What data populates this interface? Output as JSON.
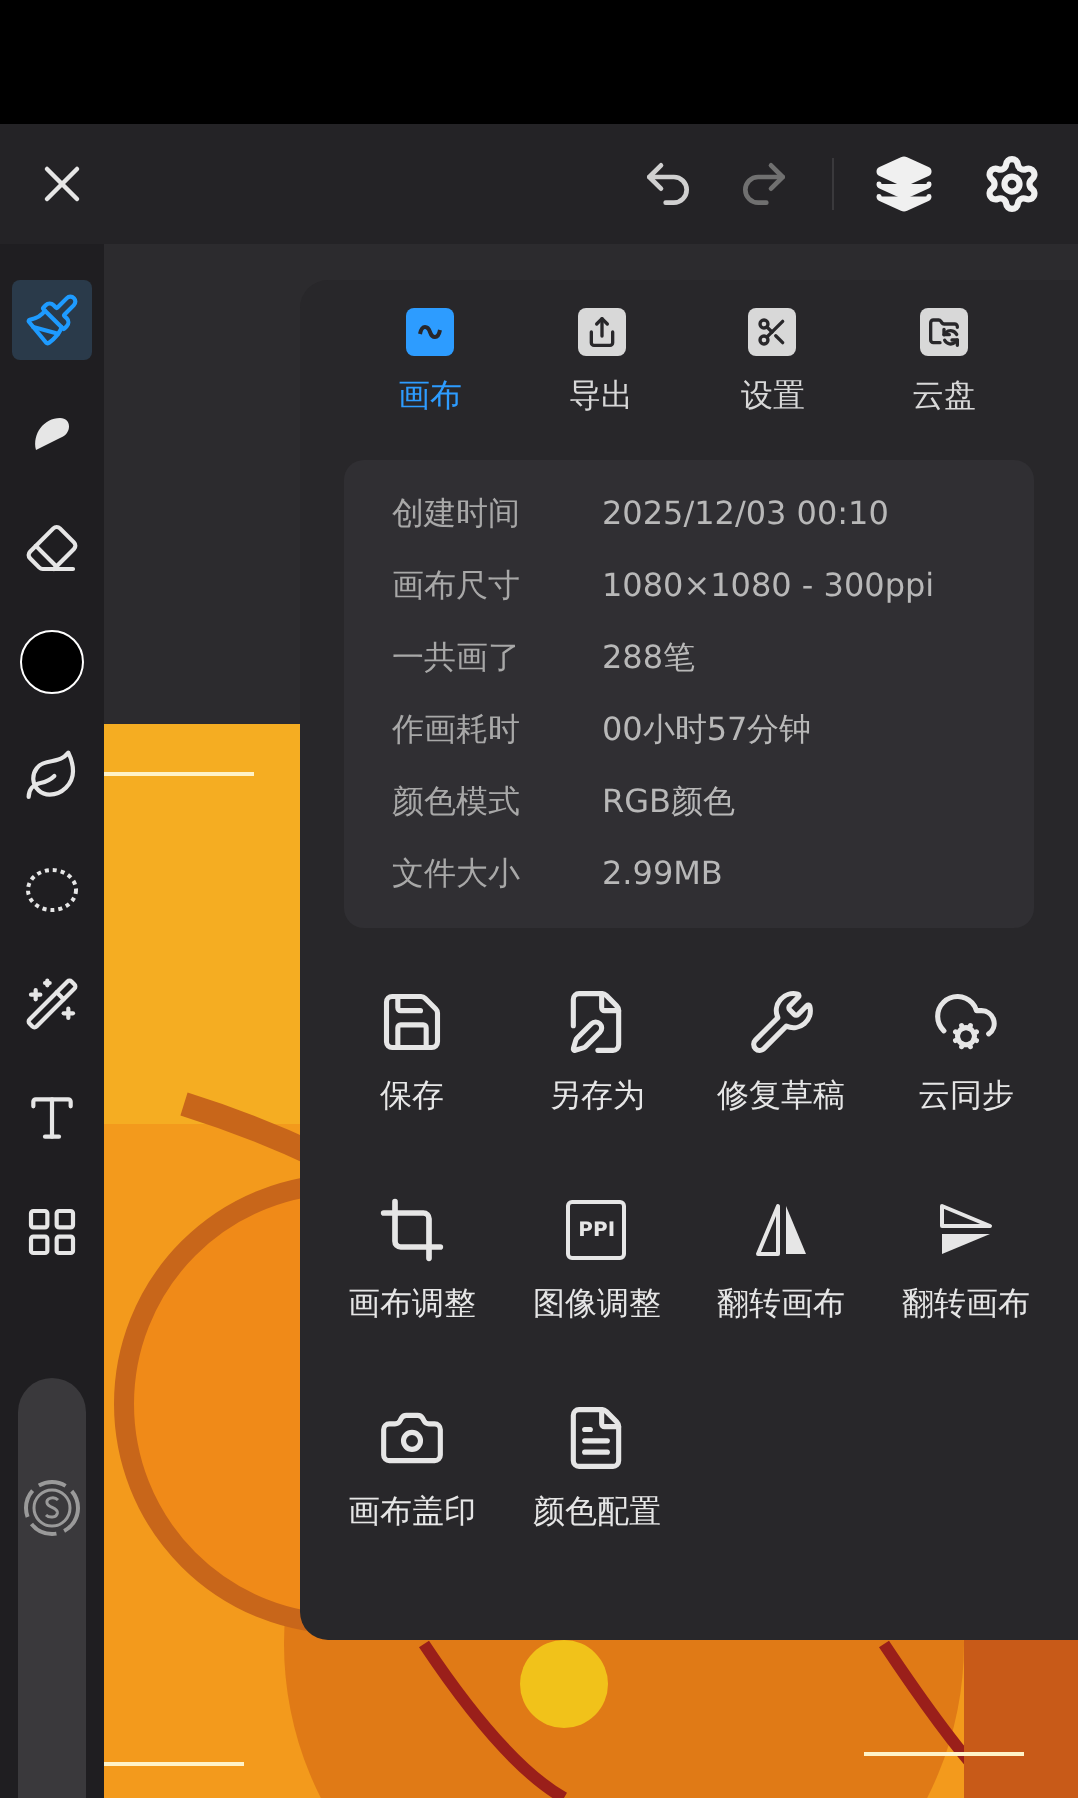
{
  "tools": [
    {
      "selected": true
    },
    {
      "selected": false
    },
    {
      "selected": false
    },
    {
      "kind": "swatch",
      "color": "#000000",
      "selected": false
    },
    {
      "selected": false
    },
    {
      "selected": false
    },
    {
      "selected": false
    },
    {
      "selected": false
    },
    {
      "selected": false
    }
  ],
  "tabs": [
    {
      "label": "画布",
      "selected": true
    },
    {
      "label": "导出",
      "selected": false
    },
    {
      "label": "设置",
      "selected": false
    },
    {
      "label": "云盘",
      "selected": false
    }
  ],
  "info": [
    {
      "label": "创建时间",
      "value": "2025/12/03 00:10"
    },
    {
      "label": "画布尺寸",
      "value": "1080×1080 - 300ppi"
    },
    {
      "label": "一共画了",
      "value": "288笔"
    },
    {
      "label": "作画耗时",
      "value": "00小时57分钟"
    },
    {
      "label": "颜色模式",
      "value": "RGB颜色"
    },
    {
      "label": "文件大小",
      "value": "2.99MB"
    }
  ],
  "actions": [
    {
      "label": "保存"
    },
    {
      "label": "另存为"
    },
    {
      "label": "修复草稿"
    },
    {
      "label": "云同步"
    },
    {
      "label": "画布调整"
    },
    {
      "label": "图像调整",
      "icon_text": "PPI"
    },
    {
      "label": "翻转画布"
    },
    {
      "label": "翻转画布"
    },
    {
      "label": "画布盖印"
    },
    {
      "label": "颜色配置"
    }
  ]
}
